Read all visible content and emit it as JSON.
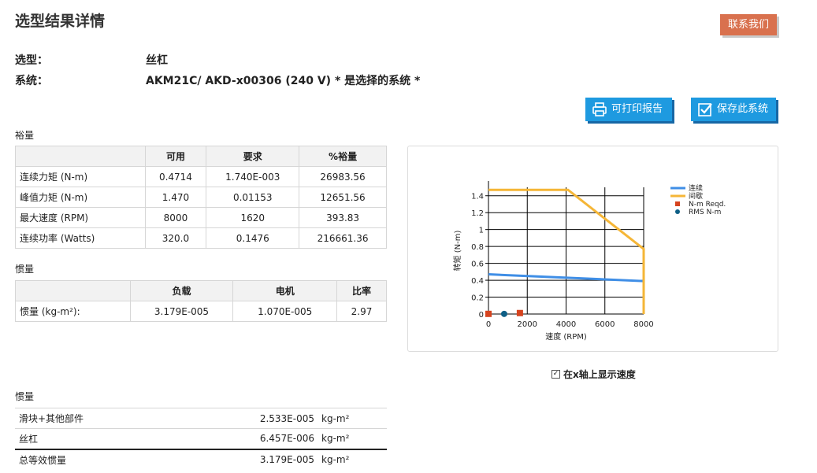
{
  "title": "选型结果详情",
  "contact_button": "联系我们",
  "info": {
    "type_label": "选型：",
    "type_value": "丝杠",
    "system_label": "系统：",
    "system_value": "AKM21C/ AKD-x00306 (240 V)  * 是选择的系统 *"
  },
  "buttons": {
    "print": "可打印报告",
    "save": "保存此系统"
  },
  "margin": {
    "section_label": "裕量",
    "headers": [
      "",
      "可用",
      "要求",
      "%裕量"
    ],
    "rows": [
      [
        "连续力矩 (N-m)",
        "0.4714",
        "1.740E-003",
        "26983.56"
      ],
      [
        "峰值力矩 (N-m)",
        "1.470",
        "0.01153",
        "12651.56"
      ],
      [
        "最大速度 (RPM)",
        "8000",
        "1620",
        "393.83"
      ],
      [
        "连续功率 (Watts)",
        "320.0",
        "0.1476",
        "216661.36"
      ]
    ]
  },
  "inertia_ratio": {
    "section_label": "惯量",
    "headers": [
      "",
      "负载",
      "电机",
      "比率"
    ],
    "row": [
      "惯量 (kg-m²):",
      "3.179E-005",
      "1.070E-005",
      "2.97"
    ]
  },
  "speed_checkbox": {
    "checked": true,
    "label": "在x轴上显示速度",
    "check_glyph": "✓"
  },
  "inertia_detail": {
    "section_label": "惯量",
    "rows": [
      [
        "滑块+其他部件",
        "2.533E-005",
        "kg-m²"
      ],
      [
        "丝杠",
        "6.457E-006",
        "kg-m²"
      ],
      [
        "总等效惯量",
        "3.179E-005",
        "kg-m²"
      ]
    ]
  },
  "chart_data": {
    "type": "line",
    "xlabel": "速度 (RPM)",
    "ylabel": "转矩 (N-m)",
    "xlim": [
      0,
      8000
    ],
    "ylim": [
      0,
      1.5
    ],
    "xticks": [
      0,
      2000,
      4000,
      6000,
      8000
    ],
    "yticks": [
      0,
      0.2,
      0.4,
      0.6,
      0.8,
      1,
      1.2,
      1.4
    ],
    "xtick_labels": [
      "0",
      "2000",
      "4000",
      "6000",
      "8000"
    ],
    "ytick_labels": [
      "0",
      "0.2",
      "0.4",
      "0.6",
      "0.8",
      "1",
      "1.2",
      "1.4"
    ],
    "grid": true,
    "legend_position": "top-right",
    "series": [
      {
        "name": "连续",
        "kind": "line",
        "color": "#3f8ee6",
        "x": [
          0,
          8000,
          8000
        ],
        "y": [
          0.47,
          0.39,
          0
        ]
      },
      {
        "name": "间歇",
        "kind": "line",
        "color": "#f5b637",
        "x": [
          0,
          4100,
          8000,
          8000
        ],
        "y": [
          1.47,
          1.47,
          0.77,
          0
        ]
      },
      {
        "name": "N-m Reqd.",
        "kind": "square",
        "color": "#d6431e",
        "x": [
          0,
          1620
        ],
        "y": [
          0.00174,
          0.01153
        ]
      },
      {
        "name": "RMS N-m",
        "kind": "circle",
        "color": "#0e5f86",
        "x": [
          810
        ],
        "y": [
          0.00174
        ]
      }
    ]
  }
}
